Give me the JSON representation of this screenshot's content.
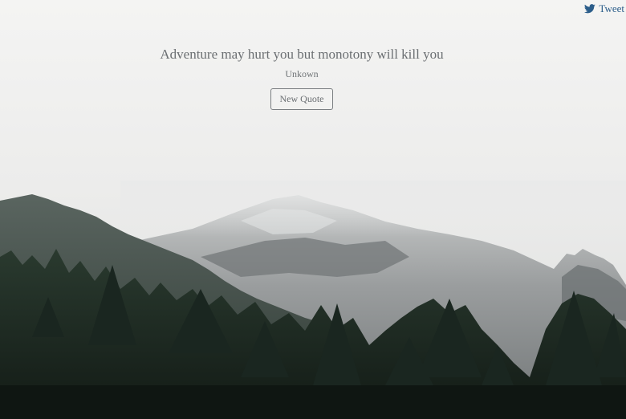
{
  "tweet": {
    "label": "Tweet",
    "icon": "twitter-bird-icon",
    "color": "#2b5d8a"
  },
  "quote": {
    "text": "Adventure may hurt you but monotony will kill you",
    "author": "Unkown"
  },
  "buttons": {
    "new_quote_label": "New Quote"
  }
}
